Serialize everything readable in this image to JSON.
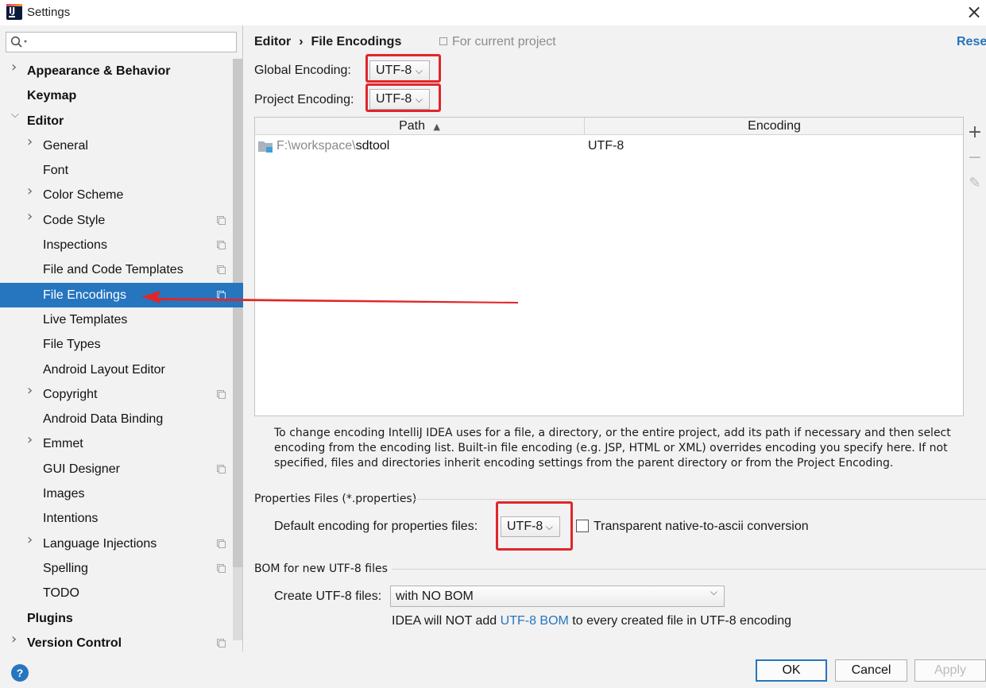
{
  "window": {
    "title": "Settings"
  },
  "search": {
    "placeholder": ""
  },
  "sidebar": {
    "items": [
      {
        "label": "Appearance & Behavior",
        "level": 0,
        "expandable": true,
        "expanded": false,
        "project": false
      },
      {
        "label": "Keymap",
        "level": 0,
        "expandable": false,
        "project": false
      },
      {
        "label": "Editor",
        "level": 0,
        "expandable": true,
        "expanded": true,
        "project": false
      },
      {
        "label": "General",
        "level": 1,
        "expandable": true,
        "expanded": false,
        "project": false
      },
      {
        "label": "Font",
        "level": 1,
        "expandable": false,
        "project": false
      },
      {
        "label": "Color Scheme",
        "level": 1,
        "expandable": true,
        "expanded": false,
        "project": false
      },
      {
        "label": "Code Style",
        "level": 1,
        "expandable": true,
        "expanded": false,
        "project": true
      },
      {
        "label": "Inspections",
        "level": 1,
        "expandable": false,
        "project": true
      },
      {
        "label": "File and Code Templates",
        "level": 1,
        "expandable": false,
        "project": true
      },
      {
        "label": "File Encodings",
        "level": 1,
        "expandable": false,
        "project": true,
        "selected": true
      },
      {
        "label": "Live Templates",
        "level": 1,
        "expandable": false,
        "project": false
      },
      {
        "label": "File Types",
        "level": 1,
        "expandable": false,
        "project": false
      },
      {
        "label": "Android Layout Editor",
        "level": 1,
        "expandable": false,
        "project": false
      },
      {
        "label": "Copyright",
        "level": 1,
        "expandable": true,
        "expanded": false,
        "project": true
      },
      {
        "label": "Android Data Binding",
        "level": 1,
        "expandable": false,
        "project": false
      },
      {
        "label": "Emmet",
        "level": 1,
        "expandable": true,
        "expanded": false,
        "project": false
      },
      {
        "label": "GUI Designer",
        "level": 1,
        "expandable": false,
        "project": true
      },
      {
        "label": "Images",
        "level": 1,
        "expandable": false,
        "project": false
      },
      {
        "label": "Intentions",
        "level": 1,
        "expandable": false,
        "project": false
      },
      {
        "label": "Language Injections",
        "level": 1,
        "expandable": true,
        "expanded": false,
        "project": true
      },
      {
        "label": "Spelling",
        "level": 1,
        "expandable": false,
        "project": true
      },
      {
        "label": "TODO",
        "level": 1,
        "expandable": false,
        "project": false
      },
      {
        "label": "Plugins",
        "level": 0,
        "expandable": false,
        "project": false
      },
      {
        "label": "Version Control",
        "level": 0,
        "expandable": true,
        "expanded": false,
        "project": true
      }
    ]
  },
  "main": {
    "breadcrumb": {
      "parent": "Editor",
      "separator": "›",
      "current": "File Encodings"
    },
    "scope_note": "For current project",
    "reset_label": "Reset",
    "global_encoding": {
      "label": "Global Encoding:",
      "value": "UTF-8"
    },
    "project_encoding": {
      "label": "Project Encoding:",
      "value": "UTF-8"
    },
    "table": {
      "columns": [
        "Path",
        "Encoding"
      ],
      "sort_indicator": "▲",
      "rows": [
        {
          "path_prefix": "F:\\workspace\\",
          "path_name": "sdtool",
          "encoding": "UTF-8"
        }
      ],
      "toolbar": {
        "add": "+",
        "remove": "−",
        "edit": "✎"
      }
    },
    "description": "To change encoding IntelliJ IDEA uses for a file, a directory, or the entire project, add its path if necessary and then select encoding from the encoding list. Built-in file encoding (e.g. JSP, HTML or XML) overrides encoding you specify here. If not specified, files and directories inherit encoding settings from the parent directory or from the Project Encoding.",
    "properties": {
      "section_title": "Properties Files (*.properties)",
      "default_label": "Default encoding for properties files:",
      "default_value": "UTF-8",
      "native_checkbox_label": "Transparent native-to-ascii conversion",
      "native_checked": false
    },
    "bom": {
      "section_title": "BOM for new UTF-8 files",
      "create_label": "Create UTF-8 files:",
      "create_value": "with NO BOM",
      "note_before": "IDEA will NOT add ",
      "note_link": "UTF-8 BOM",
      "note_after": " to every created file in UTF-8 encoding"
    }
  },
  "buttons": {
    "ok": "OK",
    "cancel": "Cancel",
    "apply": "Apply",
    "help": "?"
  },
  "colors": {
    "accent": "#2675bf",
    "highlight": "#e0262a",
    "selection": "#2675bf"
  }
}
